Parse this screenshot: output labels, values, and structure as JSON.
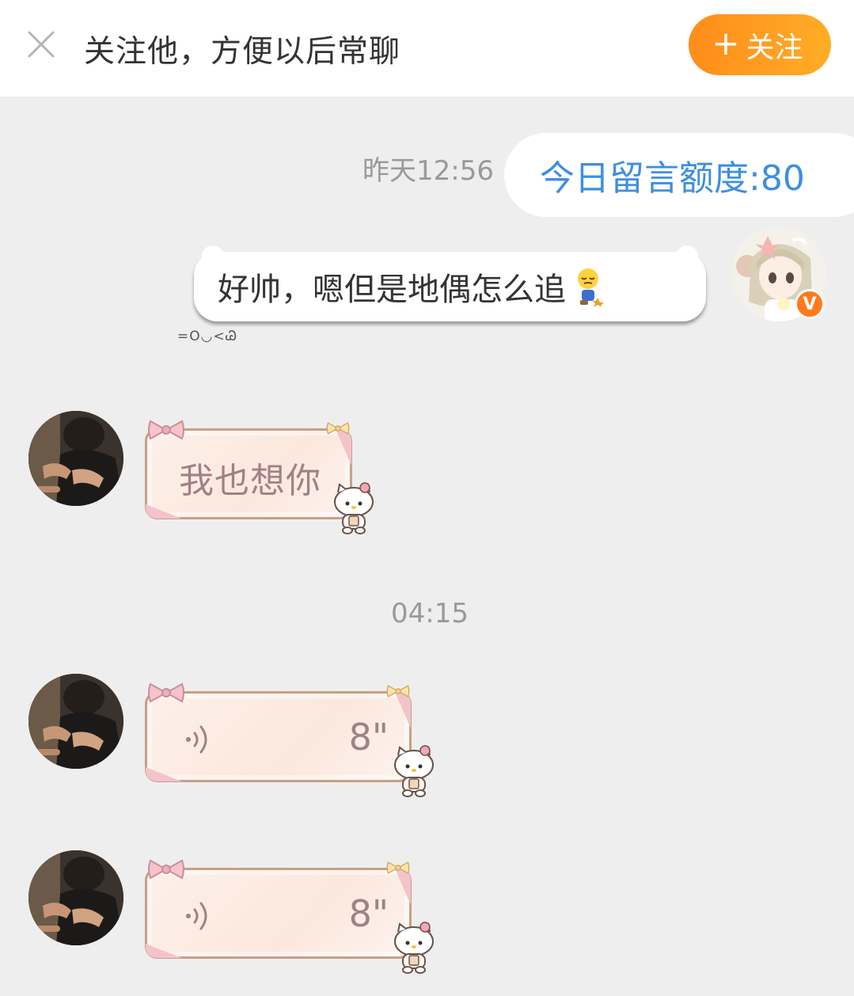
{
  "header": {
    "close_icon": "close-icon",
    "prompt": "关注他，方便以后常聊",
    "follow_button": {
      "plus": "+",
      "label": "关注"
    },
    "accent": "#ff9a1f"
  },
  "messages": {
    "time_1": "昨天12:56",
    "quota": "今日留言额度:80",
    "sent_text": "好帅，嗯但是地偶怎么追",
    "sent_emoji": "sigh-emoji",
    "face_text": "=O◡<Ꮚ",
    "verified_badge": "V",
    "received_1_text": "我也想你",
    "time_2": "04:15",
    "voice_1": {
      "icon": "voice-wave-icon",
      "duration": "8\""
    },
    "voice_2": {
      "icon": "voice-wave-icon",
      "duration": "8\""
    },
    "quota_color": "#3d8fe0",
    "bubble_text_color": "#a08186"
  }
}
